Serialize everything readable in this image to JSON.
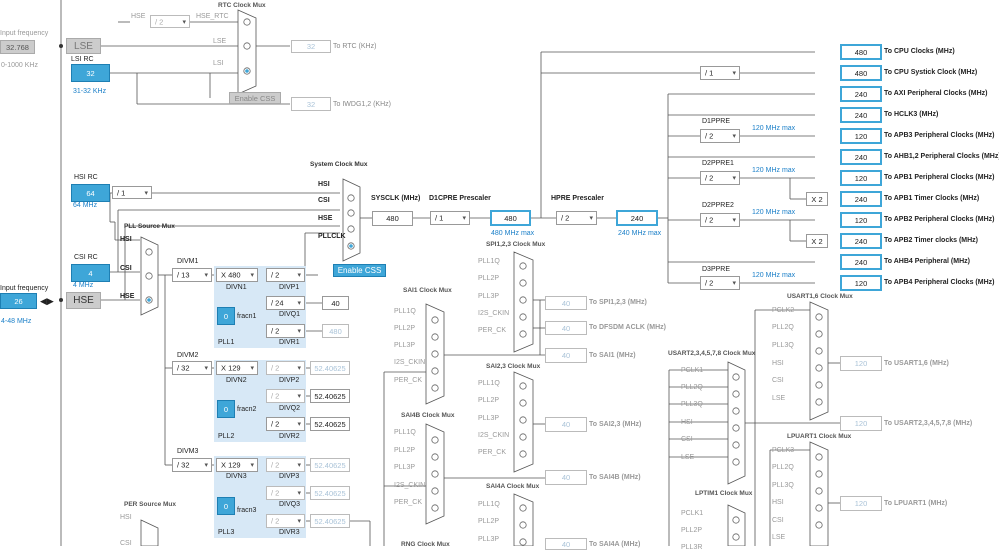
{
  "left": {
    "input_frequency_label": "Input frequency",
    "lse_value": "32.768",
    "lse_range": "0-1000 KHz",
    "lse_btn": "LSE",
    "lsi_rc_label": "LSI RC",
    "lsi_value": "32",
    "lsi_range": "31-32 KHz",
    "hsi_rc_label": "HSI RC",
    "hsi_value": "64",
    "hsi_range": "64 MHz",
    "csi_rc_label": "CSI RC",
    "csi_value": "4",
    "csi_range": "4 MHz",
    "hse_input_label": "Input frequency",
    "hse_value": "26",
    "hse_range": "4-48 MHz",
    "hse_btn": "HSE"
  },
  "rtc": {
    "mux_label": "RTC Clock Mux",
    "hse_label": "HSE",
    "hse_div": "/ 2",
    "hse_rtc_label": "HSE_RTC",
    "lse_label": "LSE",
    "lsi_label": "LSI",
    "rtc_out_value": "32",
    "rtc_out_label": "To RTC (KHz)",
    "enable_css": "Enable CSS",
    "iwdg_value": "32",
    "iwdg_label": "To IWDG1,2 (KHz)"
  },
  "hsi_div": "/ 1",
  "sysclk_mux": {
    "label": "System Clock Mux",
    "hsi": "HSI",
    "csi": "CSI",
    "hse": "HSE",
    "pllclk": "PLLCLK",
    "enable_css": "Enable CSS"
  },
  "sysclk": {
    "label": "SYSCLK (MHz)",
    "value": "480",
    "d1cpre_label": "D1CPRE Prescaler",
    "d1cpre_value": "/ 1",
    "cpu_value": "480",
    "cpu_max": "480 MHz max",
    "hpre_label": "HPRE Prescaler",
    "hpre_value": "/ 2",
    "hclk_value": "240",
    "hclk_max": "240 MHz max"
  },
  "pll_source": {
    "label": "PLL Source Mux",
    "hsi": "HSI",
    "csi": "CSI",
    "hse": "HSE"
  },
  "pll1": {
    "divm_label": "DIVM1",
    "divm_value": "/ 13",
    "divn_value": "X 480",
    "divn_label": "DIVN1",
    "divp_value": "/ 2",
    "divp_label": "DIVP1",
    "divq_value": "/ 24",
    "divq_label": "DIVQ1",
    "divq_out": "40",
    "fracn_value": "0",
    "fracn_label": "fracn1",
    "divr_value": "/ 2",
    "divr_label": "DIVR1",
    "divr_out": "480",
    "name": "PLL1"
  },
  "pll2": {
    "divm_label": "DIVM2",
    "divm_value": "/ 32",
    "divn_value": "X 129",
    "divn_label": "DIVN2",
    "divp_value": "/ 2",
    "divp_label": "DIVP2",
    "divp_out": "52.40625",
    "divq_value": "/ 2",
    "divq_label": "DIVQ2",
    "divq_out": "52.40625",
    "fracn_value": "0",
    "fracn_label": "fracn2",
    "divr_value": "/ 2",
    "divr_label": "DIVR2",
    "divr_out": "52.40625",
    "name": "PLL2"
  },
  "pll3": {
    "divm_label": "DIVM3",
    "divm_value": "/ 32",
    "divn_value": "X 129",
    "divn_label": "DIVN3",
    "divp_value": "/ 2",
    "divp_label": "DIVP3",
    "divp_out": "52.40625",
    "divq_value": "/ 2",
    "divq_label": "DIVQ3",
    "divq_out": "52.40625",
    "fracn_value": "0",
    "fracn_label": "fracn3",
    "divr_value": "/ 2",
    "divr_label": "DIVR3",
    "divr_out": "52.40625",
    "name": "PLL3"
  },
  "per_source": {
    "label": "PER Source Mux",
    "hsi": "HSI",
    "csi": "CSI"
  },
  "sai1": {
    "label": "SAI1 Clock Mux",
    "inputs": [
      "PLL1Q",
      "PLL2P",
      "PLL3P",
      "I2S_CKIN",
      "PER_CK"
    ]
  },
  "spi123": {
    "label": "SPI1,2,3 Clock Mux",
    "inputs": [
      "PLL1Q",
      "PLL2P",
      "PLL3P",
      "I2S_CKIN",
      "PER_CK"
    ],
    "out1_value": "40",
    "out1_label": "To SPI1,2,3 (MHz)",
    "out2_value": "40",
    "out2_label": "To DFSDM ACLK (MHz)",
    "out3_value": "40",
    "out3_label": "To SAI1 (MHz)"
  },
  "sai23": {
    "label": "SAI2,3 Clock Mux",
    "inputs": [
      "PLL1Q",
      "PLL2P",
      "PLL3P",
      "I2S_CKIN",
      "PER_CK"
    ],
    "out_value": "40",
    "out_label": "To SAI2,3 (MHz)"
  },
  "sai4b": {
    "label": "SAI4B Clock Mux",
    "inputs": [
      "PLL1Q",
      "PLL2P",
      "PLL3P",
      "I2S_CKIN",
      "PER_CK"
    ],
    "out_value": "40",
    "out_label": "To SAI4B (MHz)"
  },
  "sai4a": {
    "label": "SAI4A Clock Mux",
    "inputs": [
      "PLL1Q",
      "PLL2P",
      "PLL3P"
    ],
    "out_value": "40",
    "out_label": "To SAI4A (MHz)"
  },
  "rng": {
    "label": "RNG Clock Mux"
  },
  "usart16": {
    "label": "USART1,6 Clock Mux",
    "inputs": [
      "PCLK2",
      "PLL2Q",
      "PLL3Q",
      "HSI",
      "CSI",
      "LSE"
    ],
    "out_value": "120",
    "out_label": "To USART1,6 (MHz)"
  },
  "usart2": {
    "label": "USART2,3,4,5,7,8 Clock Mux",
    "inputs": [
      "PCLK1",
      "PLL2Q",
      "PLL3Q",
      "HSI",
      "CSI",
      "LSE"
    ],
    "out_value": "120",
    "out_label": "To USART2,3,4,5,7,8 (MHz)"
  },
  "lpuart1": {
    "label": "LPUART1 Clock Mux",
    "inputs": [
      "PCLK3",
      "PLL2Q",
      "PLL3Q",
      "HSI",
      "CSI",
      "LSE"
    ],
    "out_value": "120",
    "out_label": "To LPUART1 (MHz)"
  },
  "lptim1": {
    "label": "LPTIM1 Clock Mux",
    "inputs": [
      "PCLK1",
      "PLL2P",
      "PLL3R"
    ]
  },
  "right": {
    "d1ppre_label": "D1PPRE",
    "d1ppre_value": "/ 2",
    "d1ppre_max": "120 MHz max",
    "d2ppre1_label": "D2PPRE1",
    "d2ppre1_value": "/ 2",
    "d2ppre1_max": "120 MHz max",
    "d2ppre2_label": "D2PPRE2",
    "d2ppre2_value": "/ 2",
    "d2ppre2_max": "120 MHz max",
    "d3ppre_label": "D3PPRE",
    "d3ppre_value": "/ 2",
    "d3ppre_max": "120 MHz max",
    "systick_div": "/ 1",
    "x2a": "X 2",
    "x2b": "X 2",
    "outputs": [
      {
        "value": "480",
        "label": "To CPU Clocks (MHz)"
      },
      {
        "value": "480",
        "label": "To CPU Systick Clock (MHz)"
      },
      {
        "value": "240",
        "label": "To AXI Peripheral Clocks (MHz)"
      },
      {
        "value": "240",
        "label": "To HCLK3 (MHz)"
      },
      {
        "value": "120",
        "label": "To APB3 Peripheral Clocks (MHz)"
      },
      {
        "value": "240",
        "label": "To AHB1,2 Peripheral Clocks (MHz)"
      },
      {
        "value": "120",
        "label": "To APB1 Peripheral Clocks (MHz)"
      },
      {
        "value": "240",
        "label": "To APB1 Timer Clocks (MHz)"
      },
      {
        "value": "120",
        "label": "To APB2 Peripheral Clocks (MHz)"
      },
      {
        "value": "240",
        "label": "To APB2 Timer clocks (MHz)"
      },
      {
        "value": "240",
        "label": "To AHB4 Peripheral (MHz)"
      },
      {
        "value": "120",
        "label": "To APB4 Peripheral Clocks (MHz)"
      }
    ]
  }
}
